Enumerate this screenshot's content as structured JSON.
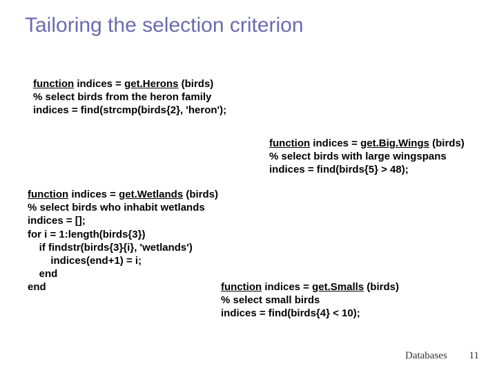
{
  "title": "Tailoring the selection criterion",
  "blocks": {
    "herons": {
      "sig_kw": "function",
      "sig_mid": " indices = ",
      "sig_name": "get.Herons",
      "sig_tail": " (birds)",
      "l2": "% select birds from the heron family",
      "l3": "indices = find(strcmp(birds{2}, 'heron');"
    },
    "bigwings": {
      "sig_kw": "function",
      "sig_mid": " indices = ",
      "sig_name": "get.Big.Wings",
      "sig_tail": " (birds)",
      "l2": "% select birds with large wingspans",
      "l3": "indices = find(birds{5} > 48);"
    },
    "wetlands": {
      "sig_kw": "function",
      "sig_mid": " indices = ",
      "sig_name": "get.Wetlands",
      "sig_tail": " (birds)",
      "l2": "% select birds who inhabit wetlands",
      "l3": "indices = [];",
      "l4": "for i = 1:length(birds{3})",
      "l5": "    if findstr(birds{3}{i}, 'wetlands')",
      "l6": "        indices(end+1) = i;",
      "l7": "    end",
      "l8": "end"
    },
    "smalls": {
      "sig_kw": "function",
      "sig_mid": " indices = ",
      "sig_name": "get.Smalls",
      "sig_tail": " (birds)",
      "l2": "% select small birds",
      "l3": "indices = find(birds{4} < 10);"
    }
  },
  "footer": {
    "label": "Databases",
    "page": "11"
  }
}
